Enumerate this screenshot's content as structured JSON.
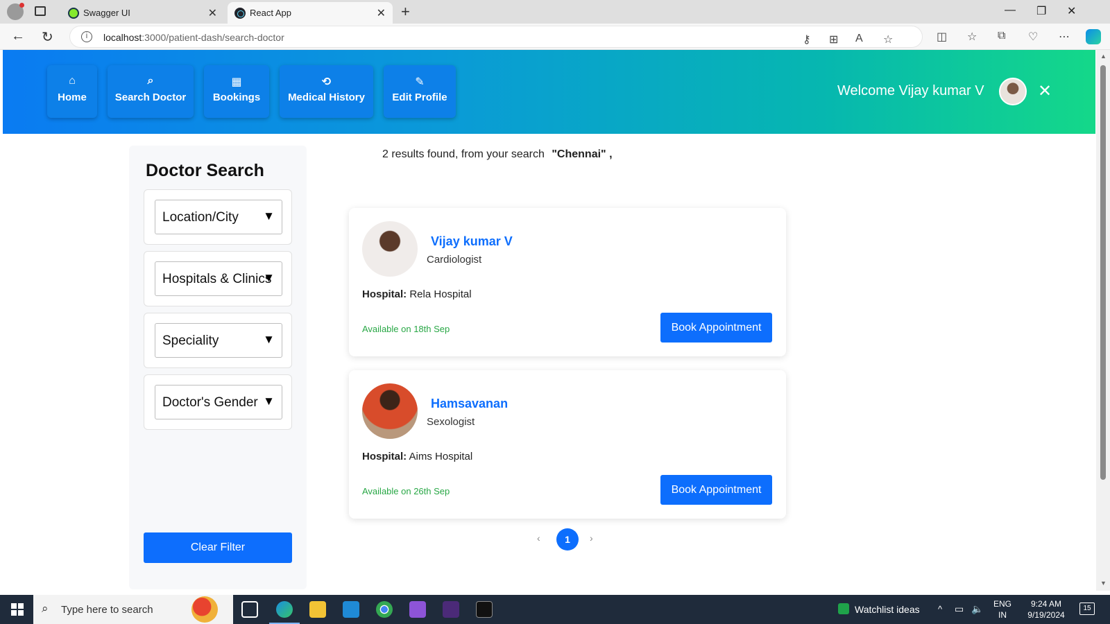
{
  "browser": {
    "tabs": [
      {
        "title": "Swagger UI",
        "active": false
      },
      {
        "title": "React App",
        "active": true
      }
    ],
    "url_host": "localhost",
    "url_path": ":3000/patient-dash/search-doctor"
  },
  "header": {
    "nav": [
      {
        "label": "Home",
        "icon": "home-icon"
      },
      {
        "label": "Search Doctor",
        "icon": "search-icon"
      },
      {
        "label": "Bookings",
        "icon": "calendar-icon"
      },
      {
        "label": "Medical History",
        "icon": "history-icon"
      },
      {
        "label": "Edit Profile",
        "icon": "pencil-icon"
      }
    ],
    "welcome": "Welcome Vijay kumar V",
    "colors": {
      "gradient_start": "#0a7bf2",
      "gradient_end": "#14d889"
    }
  },
  "sidebar": {
    "title": "Doctor Search",
    "filters": [
      {
        "label": "Location/City"
      },
      {
        "label": "Hospitals & Clinics"
      },
      {
        "label": "Speciality"
      },
      {
        "label": "Doctor's Gender"
      }
    ],
    "clear_label": "Clear Filter"
  },
  "results": {
    "prefix": "2 results found, from your search",
    "query": "\"Chennai\" ,",
    "doctors": [
      {
        "name": "Vijay kumar V",
        "speciality": "Cardiologist",
        "hospital_label": "Hospital:",
        "hospital": "Rela Hospital",
        "availability": "Available on 18th Sep",
        "book_label": "Book Appointment"
      },
      {
        "name": "Hamsavanan",
        "speciality": "Sexologist",
        "hospital_label": "Hospital:",
        "hospital": "Aims Hospital",
        "availability": "Available on 26th Sep",
        "book_label": "Book Appointment"
      }
    ],
    "pagination": {
      "current_page": "1"
    }
  },
  "taskbar": {
    "search_placeholder": "Type here to search",
    "watchlist": "Watchlist ideas",
    "lang": "ENG",
    "region": "IN",
    "time": "9:24 AM",
    "date": "9/19/2024",
    "notifications": "15"
  },
  "colors": {
    "primary": "#0d6efd",
    "available": "#28a745"
  }
}
